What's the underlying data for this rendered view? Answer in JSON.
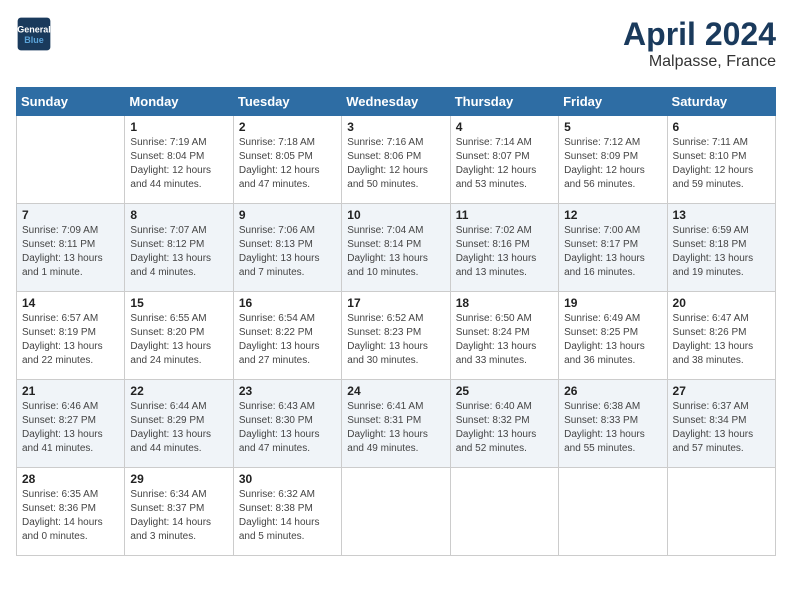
{
  "header": {
    "logo_line1": "General",
    "logo_line2": "Blue",
    "month": "April 2024",
    "location": "Malpasse, France"
  },
  "columns": [
    "Sunday",
    "Monday",
    "Tuesday",
    "Wednesday",
    "Thursday",
    "Friday",
    "Saturday"
  ],
  "weeks": [
    [
      {
        "day": "",
        "info": ""
      },
      {
        "day": "1",
        "info": "Sunrise: 7:19 AM\nSunset: 8:04 PM\nDaylight: 12 hours\nand 44 minutes."
      },
      {
        "day": "2",
        "info": "Sunrise: 7:18 AM\nSunset: 8:05 PM\nDaylight: 12 hours\nand 47 minutes."
      },
      {
        "day": "3",
        "info": "Sunrise: 7:16 AM\nSunset: 8:06 PM\nDaylight: 12 hours\nand 50 minutes."
      },
      {
        "day": "4",
        "info": "Sunrise: 7:14 AM\nSunset: 8:07 PM\nDaylight: 12 hours\nand 53 minutes."
      },
      {
        "day": "5",
        "info": "Sunrise: 7:12 AM\nSunset: 8:09 PM\nDaylight: 12 hours\nand 56 minutes."
      },
      {
        "day": "6",
        "info": "Sunrise: 7:11 AM\nSunset: 8:10 PM\nDaylight: 12 hours\nand 59 minutes."
      }
    ],
    [
      {
        "day": "7",
        "info": "Sunrise: 7:09 AM\nSunset: 8:11 PM\nDaylight: 13 hours\nand 1 minute."
      },
      {
        "day": "8",
        "info": "Sunrise: 7:07 AM\nSunset: 8:12 PM\nDaylight: 13 hours\nand 4 minutes."
      },
      {
        "day": "9",
        "info": "Sunrise: 7:06 AM\nSunset: 8:13 PM\nDaylight: 13 hours\nand 7 minutes."
      },
      {
        "day": "10",
        "info": "Sunrise: 7:04 AM\nSunset: 8:14 PM\nDaylight: 13 hours\nand 10 minutes."
      },
      {
        "day": "11",
        "info": "Sunrise: 7:02 AM\nSunset: 8:16 PM\nDaylight: 13 hours\nand 13 minutes."
      },
      {
        "day": "12",
        "info": "Sunrise: 7:00 AM\nSunset: 8:17 PM\nDaylight: 13 hours\nand 16 minutes."
      },
      {
        "day": "13",
        "info": "Sunrise: 6:59 AM\nSunset: 8:18 PM\nDaylight: 13 hours\nand 19 minutes."
      }
    ],
    [
      {
        "day": "14",
        "info": "Sunrise: 6:57 AM\nSunset: 8:19 PM\nDaylight: 13 hours\nand 22 minutes."
      },
      {
        "day": "15",
        "info": "Sunrise: 6:55 AM\nSunset: 8:20 PM\nDaylight: 13 hours\nand 24 minutes."
      },
      {
        "day": "16",
        "info": "Sunrise: 6:54 AM\nSunset: 8:22 PM\nDaylight: 13 hours\nand 27 minutes."
      },
      {
        "day": "17",
        "info": "Sunrise: 6:52 AM\nSunset: 8:23 PM\nDaylight: 13 hours\nand 30 minutes."
      },
      {
        "day": "18",
        "info": "Sunrise: 6:50 AM\nSunset: 8:24 PM\nDaylight: 13 hours\nand 33 minutes."
      },
      {
        "day": "19",
        "info": "Sunrise: 6:49 AM\nSunset: 8:25 PM\nDaylight: 13 hours\nand 36 minutes."
      },
      {
        "day": "20",
        "info": "Sunrise: 6:47 AM\nSunset: 8:26 PM\nDaylight: 13 hours\nand 38 minutes."
      }
    ],
    [
      {
        "day": "21",
        "info": "Sunrise: 6:46 AM\nSunset: 8:27 PM\nDaylight: 13 hours\nand 41 minutes."
      },
      {
        "day": "22",
        "info": "Sunrise: 6:44 AM\nSunset: 8:29 PM\nDaylight: 13 hours\nand 44 minutes."
      },
      {
        "day": "23",
        "info": "Sunrise: 6:43 AM\nSunset: 8:30 PM\nDaylight: 13 hours\nand 47 minutes."
      },
      {
        "day": "24",
        "info": "Sunrise: 6:41 AM\nSunset: 8:31 PM\nDaylight: 13 hours\nand 49 minutes."
      },
      {
        "day": "25",
        "info": "Sunrise: 6:40 AM\nSunset: 8:32 PM\nDaylight: 13 hours\nand 52 minutes."
      },
      {
        "day": "26",
        "info": "Sunrise: 6:38 AM\nSunset: 8:33 PM\nDaylight: 13 hours\nand 55 minutes."
      },
      {
        "day": "27",
        "info": "Sunrise: 6:37 AM\nSunset: 8:34 PM\nDaylight: 13 hours\nand 57 minutes."
      }
    ],
    [
      {
        "day": "28",
        "info": "Sunrise: 6:35 AM\nSunset: 8:36 PM\nDaylight: 14 hours\nand 0 minutes."
      },
      {
        "day": "29",
        "info": "Sunrise: 6:34 AM\nSunset: 8:37 PM\nDaylight: 14 hours\nand 3 minutes."
      },
      {
        "day": "30",
        "info": "Sunrise: 6:32 AM\nSunset: 8:38 PM\nDaylight: 14 hours\nand 5 minutes."
      },
      {
        "day": "",
        "info": ""
      },
      {
        "day": "",
        "info": ""
      },
      {
        "day": "",
        "info": ""
      },
      {
        "day": "",
        "info": ""
      }
    ]
  ]
}
